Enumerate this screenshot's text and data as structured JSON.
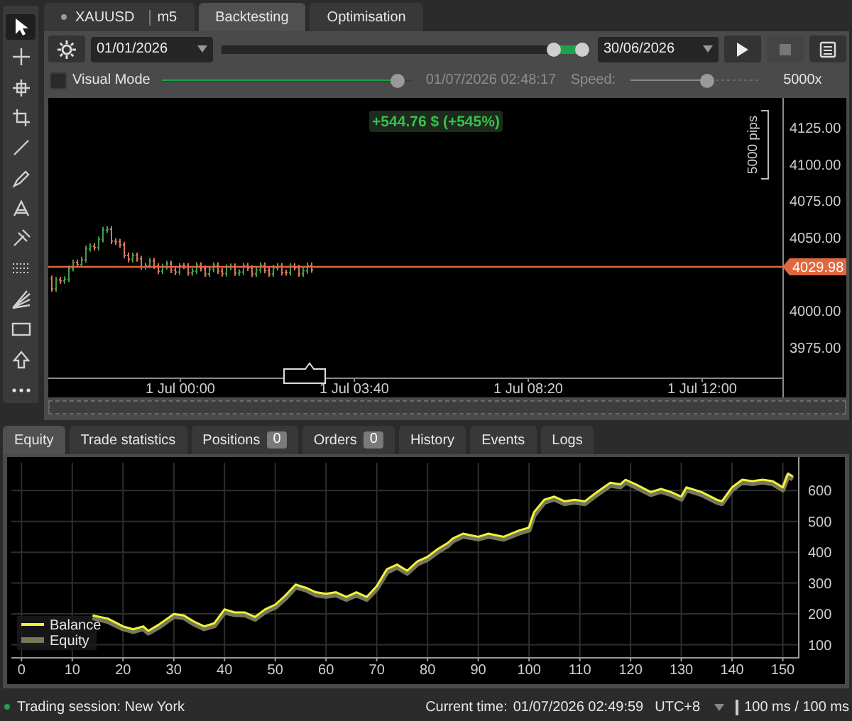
{
  "toolbar": {
    "tools": [
      {
        "kind": "pointer",
        "selected": true
      },
      {
        "kind": "crosshair",
        "selected": false
      },
      {
        "kind": "crosshair-plus",
        "selected": false
      },
      {
        "kind": "crop",
        "selected": false
      },
      {
        "kind": "line",
        "selected": false
      },
      {
        "kind": "pen",
        "selected": false
      },
      {
        "kind": "hatch",
        "selected": false
      },
      {
        "kind": "pitchfork",
        "selected": false
      },
      {
        "kind": "grid",
        "selected": false
      },
      {
        "kind": "fan",
        "selected": false
      },
      {
        "kind": "rectangle",
        "selected": false
      },
      {
        "kind": "arrow",
        "selected": false
      },
      {
        "kind": "more",
        "selected": false
      }
    ]
  },
  "tabs": [
    {
      "kind": "symbol",
      "symbol": "XAUUSD",
      "timeframe": "m5",
      "selected": false
    },
    {
      "kind": "plain",
      "label": "Backtesting",
      "selected": true
    },
    {
      "kind": "plain",
      "label": "Optimisation",
      "selected": false
    }
  ],
  "controls": {
    "start_date": "01/01/2026",
    "range": {
      "level": 0.92
    },
    "end_date": "30/06/2026",
    "buttons": [
      {
        "kind": "play",
        "disabled": false
      },
      {
        "kind": "stop",
        "disabled": true
      },
      {
        "kind": "save",
        "disabled": false
      }
    ]
  },
  "visual_mode": {
    "label": "Visual Mode",
    "checked": false,
    "progress": {
      "level": 0.97
    },
    "time": "01/07/2026 02:48:17",
    "speed_label": "Speed:",
    "speed": {
      "level": 0.62
    },
    "speed_value": "5000x"
  },
  "price_chart": {
    "profit": "+544.76 $ (+545%)",
    "scale": "5000 pips",
    "price_labels": [
      "4125.00",
      "4100.00",
      "4075.00",
      "4050.00",
      "4000.00",
      "3975.00"
    ],
    "current_price": "4029.98",
    "time_labels": [
      "1 Jul 00:00",
      "1 Jul 03:40",
      "1 Jul 08:20",
      "1 Jul 12:00"
    ]
  },
  "bottom_tabs": [
    {
      "label": "Equity",
      "selected": true
    },
    {
      "label": "Trade statistics",
      "selected": false
    },
    {
      "label": "Positions",
      "count": "0",
      "selected": false
    },
    {
      "label": "Orders",
      "count": "0",
      "selected": false
    },
    {
      "label": "History",
      "selected": false
    },
    {
      "label": "Events",
      "selected": false
    },
    {
      "label": "Logs",
      "selected": false
    }
  ],
  "equity": {
    "chart_data": {
      "type": "line",
      "x": [
        14,
        17,
        20,
        22,
        24,
        25,
        27,
        30,
        32,
        34,
        36,
        38,
        40,
        42,
        44,
        46,
        48,
        50,
        52,
        54,
        56,
        58,
        60,
        62,
        64,
        66,
        68,
        70,
        72,
        74,
        76,
        78,
        80,
        82,
        84,
        85,
        87,
        90,
        92,
        95,
        98,
        100,
        101,
        103,
        105,
        107,
        109,
        111,
        113,
        116,
        118,
        119,
        121,
        124,
        126,
        128,
        130,
        131,
        134,
        137,
        138,
        140,
        142,
        144,
        146,
        148,
        150,
        151,
        152
      ],
      "series": [
        {
          "name": "Balance",
          "color": "#f2f23a",
          "values": [
            195,
            185,
            160,
            150,
            160,
            145,
            165,
            200,
            195,
            175,
            160,
            170,
            215,
            205,
            205,
            190,
            215,
            230,
            260,
            295,
            285,
            270,
            265,
            270,
            255,
            270,
            255,
            290,
            345,
            360,
            340,
            370,
            385,
            410,
            430,
            445,
            460,
            450,
            460,
            450,
            470,
            480,
            530,
            570,
            580,
            565,
            570,
            565,
            590,
            625,
            620,
            635,
            620,
            595,
            605,
            595,
            580,
            610,
            595,
            570,
            565,
            610,
            635,
            630,
            635,
            630,
            610,
            655,
            645
          ]
        },
        {
          "name": "Equity",
          "color": "#77775a",
          "values": [
            188,
            176,
            152,
            143,
            152,
            138,
            157,
            192,
            188,
            167,
            152,
            162,
            206,
            198,
            197,
            183,
            207,
            222,
            251,
            287,
            278,
            262,
            257,
            262,
            247,
            262,
            247,
            281,
            336,
            352,
            332,
            362,
            377,
            401,
            421,
            437,
            452,
            443,
            452,
            442,
            462,
            472,
            520,
            562,
            572,
            557,
            562,
            557,
            582,
            617,
            612,
            627,
            612,
            587,
            597,
            587,
            572,
            602,
            587,
            562,
            557,
            602,
            627,
            622,
            627,
            622,
            602,
            647,
            637
          ]
        }
      ],
      "xlim": [
        -2,
        153
      ],
      "ylim": [
        60,
        690
      ],
      "xticks": [
        0,
        10,
        20,
        30,
        40,
        50,
        60,
        70,
        80,
        90,
        100,
        110,
        120,
        130,
        140,
        150
      ],
      "yticks": [
        100,
        200,
        300,
        400,
        500,
        600
      ],
      "grid": true,
      "legend": true
    }
  },
  "status_bar": {
    "session_active": true,
    "session": "Trading session: New York",
    "time_label": "Current time:",
    "time": "01/07/2026 02:49:59",
    "timezone": "UTC+8",
    "latency": "100 ms / 100 ms"
  }
}
